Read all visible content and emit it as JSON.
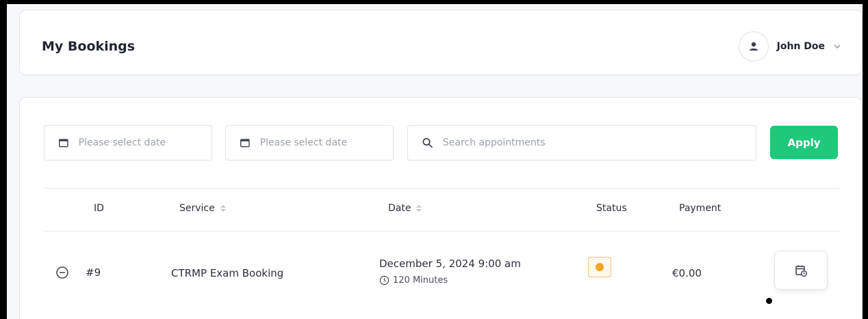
{
  "header": {
    "title": "My Bookings",
    "user_name": "John Doe",
    "icons": {
      "avatar": "user-icon",
      "menu": "chevron-down-icon"
    }
  },
  "filters": {
    "start_date": {
      "placeholder": "Please select date",
      "value": "",
      "icon": "calendar-icon"
    },
    "end_date": {
      "placeholder": "Please select date",
      "value": "",
      "icon": "calendar-icon"
    },
    "search": {
      "placeholder": "Search appointments",
      "value": "",
      "icon": "search-icon"
    },
    "apply_label": "Apply"
  },
  "table": {
    "columns": [
      "ID",
      "Service",
      "Date",
      "Status",
      "Payment"
    ],
    "rows": [
      {
        "id": "#9",
        "service": "CTRMP Exam Booking",
        "date": "December 5, 2024 9:00 am",
        "duration": "120 Minutes",
        "status_color": "#f5a623",
        "payment": "€0.00"
      }
    ]
  },
  "colors": {
    "accent": "#1ec97a",
    "pending": "#f5a623"
  }
}
